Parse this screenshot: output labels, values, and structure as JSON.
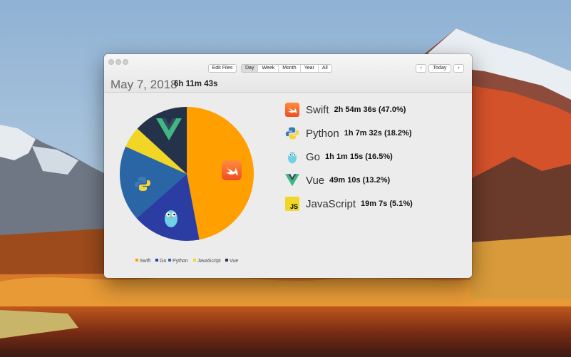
{
  "toolbar": {
    "edit_files": "Edit Files",
    "ranges": [
      "Day",
      "Week",
      "Month",
      "Year",
      "All"
    ],
    "active_range": "Day",
    "today": "Today",
    "prev_icon": "chevron-left-icon",
    "next_icon": "chevron-right-icon"
  },
  "summary": {
    "date": "May 7, 2018",
    "total": "6h 11m 43s"
  },
  "colors": {
    "swift": "#ff9f00",
    "go": "#2b3ca3",
    "python": "#2a65a6",
    "javascript": "#f1d625",
    "vue": "#24324a"
  },
  "chart_data": {
    "type": "pie",
    "values_percent": [
      {
        "label": "Swift",
        "value": 47.0
      },
      {
        "label": "Go",
        "value": 16.5
      },
      {
        "label": "Python",
        "value": 18.2
      },
      {
        "label": "JavaScript",
        "value": 5.1
      },
      {
        "label": "Vue",
        "value": 13.2
      }
    ],
    "legend": [
      "Swift",
      "Go",
      "Python",
      "JavaScript",
      "Vue"
    ],
    "legend_placement": "bottom"
  },
  "languages": [
    {
      "name": "Swift",
      "duration": "2h 54m 36s (47.0%)",
      "icon": "swift-icon"
    },
    {
      "name": "Python",
      "duration": "1h 7m 32s (18.2%)",
      "icon": "python-icon"
    },
    {
      "name": "Go",
      "duration": "1h 1m 15s (16.5%)",
      "icon": "go-gopher-icon"
    },
    {
      "name": "Vue",
      "duration": "49m 10s (13.2%)",
      "icon": "vue-icon"
    },
    {
      "name": "JavaScript",
      "duration": "19m 7s (5.1%)",
      "icon": "javascript-icon"
    }
  ]
}
